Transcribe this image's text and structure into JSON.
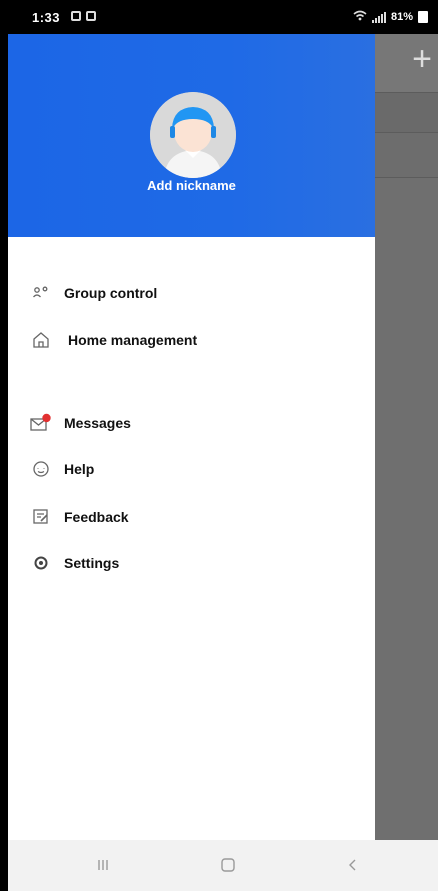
{
  "status_bar": {
    "time": "1:33",
    "battery": "81%"
  },
  "background": {
    "add_icon": "plus-icon"
  },
  "drawer": {
    "nickname": "Add nickname",
    "menu": [
      {
        "label": "Group control",
        "icon": "group-icon"
      },
      {
        "label": "Home management",
        "icon": "home-icon"
      },
      {
        "label": "Messages",
        "icon": "messages-icon",
        "badge": true
      },
      {
        "label": "Help",
        "icon": "help-icon"
      },
      {
        "label": "Feedback",
        "icon": "feedback-icon"
      },
      {
        "label": "Settings",
        "icon": "settings-icon"
      }
    ]
  },
  "nav_bar": {
    "recents": "recents-icon",
    "home": "home-button-icon",
    "back": "back-icon"
  },
  "colors": {
    "header_blue": "#1f6ae6",
    "badge_red": "#e23030"
  }
}
